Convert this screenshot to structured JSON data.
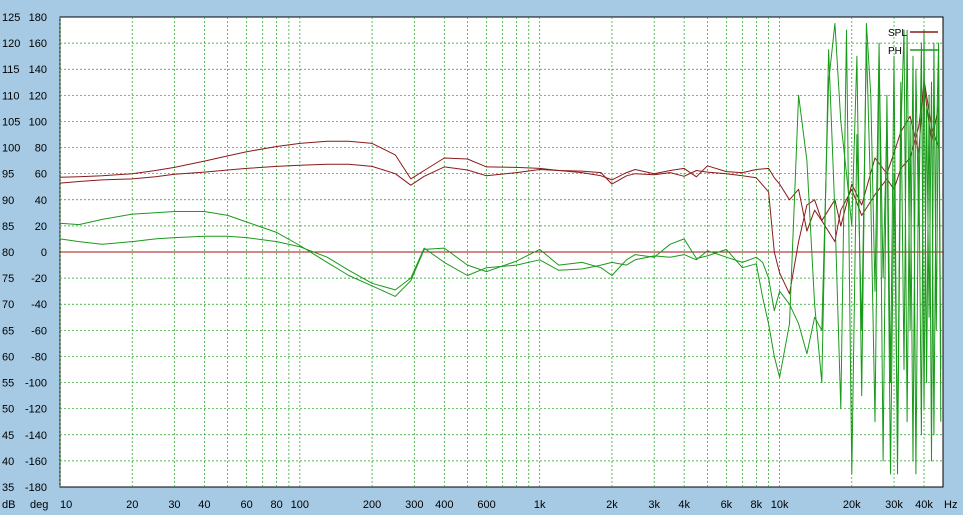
{
  "chart_data": {
    "type": "line",
    "xscale": "log",
    "xlim": [
      10,
      48000
    ],
    "ylim_db": [
      35,
      125
    ],
    "ylim_deg": [
      -180,
      180
    ],
    "grid": true,
    "legend_placement": "top-right",
    "legend": [
      {
        "label": "SPL",
        "color": "#8b1a1a"
      },
      {
        "label": "PH",
        "color": "#1a9a1a"
      }
    ],
    "y_left_ticks": [
      "125",
      "120",
      "115",
      "110",
      "105",
      "100",
      "95",
      "90",
      "85",
      "80",
      "75",
      "70",
      "65",
      "60",
      "55",
      "50",
      "45",
      "40",
      "35"
    ],
    "y_right_ticks": [
      "180",
      "160",
      "140",
      "120",
      "100",
      "80",
      "60",
      "40",
      "20",
      "0",
      "-20",
      "-40",
      "-60",
      "-80",
      "-100",
      "-120",
      "-140",
      "-160",
      "-180"
    ],
    "y_left_unit": "dB",
    "y_right_unit": "deg",
    "x_ticks": [
      {
        "v": 10,
        "label": "10"
      },
      {
        "v": 20,
        "label": "20"
      },
      {
        "v": 30,
        "label": "30"
      },
      {
        "v": 40,
        "label": "40"
      },
      {
        "v": 60,
        "label": "60"
      },
      {
        "v": 80,
        "label": "80"
      },
      {
        "v": 100,
        "label": "100"
      },
      {
        "v": 200,
        "label": "200"
      },
      {
        "v": 300,
        "label": "300"
      },
      {
        "v": 400,
        "label": "400"
      },
      {
        "v": 600,
        "label": "600"
      },
      {
        "v": 1000,
        "label": "1k"
      },
      {
        "v": 2000,
        "label": "2k"
      },
      {
        "v": 3000,
        "label": "3k"
      },
      {
        "v": 4000,
        "label": "4k"
      },
      {
        "v": 6000,
        "label": "6k"
      },
      {
        "v": 8000,
        "label": "8k"
      },
      {
        "v": 10000,
        "label": "10k"
      },
      {
        "v": 20000,
        "label": "20k"
      },
      {
        "v": 30000,
        "label": "30k"
      },
      {
        "v": 40000,
        "label": "40k"
      }
    ],
    "x_unit": "Hz",
    "zero_line_db": 80,
    "series": [
      {
        "name": "SPL",
        "color": "#8b1a1a",
        "x": [
          10,
          12,
          15,
          20,
          25,
          30,
          40,
          50,
          60,
          80,
          100,
          130,
          160,
          200,
          250,
          290,
          330,
          400,
          500,
          600,
          800,
          1000,
          1200,
          1500,
          1800,
          2000,
          2300,
          2500,
          3000,
          3500,
          4000,
          4500,
          5000,
          6000,
          7000,
          8000,
          9000,
          9500,
          10000,
          11000,
          12000,
          13000,
          14000,
          15000,
          17000,
          18000,
          20000,
          22000,
          25000,
          28000,
          30000,
          32000,
          35000,
          38000,
          40000,
          43000,
          46000
        ],
        "y": [
          93.2,
          93.5,
          93.8,
          94,
          94.4,
          94.9,
          95.3,
          95.7,
          96.0,
          96.4,
          96.6,
          96.8,
          96.8,
          96.4,
          95.0,
          92.8,
          94.5,
          96.3,
          95.7,
          94.6,
          95.2,
          95.8,
          95.6,
          95.5,
          95.2,
          93.0,
          94.6,
          95.0,
          94.8,
          95.2,
          94.5,
          95.6,
          95.3,
          95.0,
          94.6,
          94.2,
          91.5,
          80.0,
          76.0,
          72.0,
          82.0,
          89.0,
          90.0,
          86.0,
          82.0,
          88.0,
          92.0,
          87.0,
          91.0,
          94.0,
          92.0,
          96.0,
          98.0,
          104.0,
          112.0,
          101.0,
          108.0
        ]
      },
      {
        "name": "SPL",
        "color": "#8b1a1a",
        "x": [
          10,
          12,
          15,
          20,
          25,
          30,
          40,
          50,
          60,
          80,
          100,
          130,
          160,
          200,
          250,
          290,
          330,
          400,
          500,
          600,
          800,
          1000,
          1200,
          1500,
          1800,
          2000,
          2300,
          2500,
          3000,
          3500,
          4000,
          4500,
          5000,
          6000,
          7000,
          8000,
          9000,
          9500,
          10000,
          11000,
          12000,
          13000,
          14000,
          15000,
          17000,
          18000,
          20000,
          22000,
          25000,
          28000,
          30000,
          32000,
          35000,
          38000,
          40000,
          43000,
          46000
        ],
        "y": [
          94.3,
          94.4,
          94.6,
          95.0,
          95.6,
          96.2,
          97.4,
          98.4,
          99.2,
          100.2,
          100.8,
          101.2,
          101.2,
          100.8,
          98.6,
          94.0,
          95.6,
          98.0,
          97.8,
          96.3,
          96.2,
          96.0,
          95.6,
          95.2,
          94.6,
          93.8,
          95.2,
          95.8,
          95.0,
          95.6,
          96.0,
          94.4,
          96.5,
          95.4,
          95.2,
          95.8,
          96.0,
          94.2,
          93.0,
          90.0,
          92.0,
          84.0,
          88.0,
          86.0,
          90.0,
          85.0,
          93.0,
          89.0,
          98.0,
          95.0,
          99.0,
          103.0,
          106.0,
          99.0,
          113.0,
          104.0,
          100.0
        ]
      },
      {
        "name": "PH",
        "color": "#1a9a1a",
        "x": [
          10,
          12,
          15,
          20,
          25,
          30,
          40,
          50,
          60,
          80,
          100,
          130,
          160,
          200,
          250,
          290,
          330,
          400,
          500,
          600,
          800,
          1000,
          1200,
          1500,
          1800,
          2000,
          2300,
          2500,
          3000,
          3500,
          4000,
          4500,
          5000,
          6000,
          7000,
          8000,
          8500,
          9000,
          9500,
          10000,
          11000,
          12000,
          13000,
          14000,
          15000,
          16000,
          17000,
          18000,
          19000,
          20000,
          21000,
          22000,
          23000,
          24000,
          25000,
          26000,
          27000,
          28000,
          29000,
          30000,
          31000,
          32000,
          33000,
          34000,
          35000,
          36000,
          37000,
          38000,
          39000,
          40000,
          41000,
          42000,
          43000,
          44000,
          45000,
          46000,
          47000
        ],
        "y": [
          22,
          21,
          25,
          29,
          30,
          31,
          31,
          28,
          23,
          15,
          5,
          -8,
          -18,
          -26,
          -34,
          -22,
          2,
          3,
          -10,
          -15,
          -7,
          2,
          -10,
          -8,
          -12,
          -18,
          -6,
          -2,
          -4,
          6,
          10,
          -5,
          -3,
          2,
          -12,
          -9,
          -35,
          -55,
          -80,
          -96,
          -55,
          120,
          70,
          -40,
          -100,
          155,
          30,
          -120,
          170,
          -170,
          90,
          -60,
          160,
          40,
          -130,
          150,
          -20,
          100,
          -170,
          60,
          -150,
          130,
          -90,
          170,
          -60,
          150,
          -170,
          80,
          -140,
          170,
          -100,
          120,
          -160,
          160,
          -60,
          140,
          -130
        ]
      },
      {
        "name": "PH",
        "color": "#1a9a1a",
        "x": [
          10,
          12,
          15,
          20,
          25,
          30,
          40,
          50,
          60,
          80,
          100,
          130,
          160,
          200,
          250,
          290,
          330,
          400,
          500,
          600,
          800,
          1000,
          1200,
          1500,
          1800,
          2000,
          2300,
          2500,
          3000,
          3500,
          4000,
          4500,
          5000,
          6000,
          7000,
          8000,
          8500,
          9000,
          9500,
          10000,
          11000,
          12000,
          13000,
          14000,
          15000,
          16000,
          17000,
          18000,
          19000,
          20000,
          21000,
          22000,
          23000,
          24000,
          25000,
          26000,
          27000,
          28000,
          29000,
          30000,
          31000,
          32000,
          33000,
          34000,
          35000,
          36000,
          37000,
          38000,
          39000,
          40000,
          41000,
          42000,
          43000,
          44000,
          45000,
          46000,
          47000
        ],
        "y": [
          10,
          8,
          6,
          8,
          10,
          11,
          12,
          12,
          11,
          8,
          4,
          -4,
          -14,
          -24,
          -29,
          -20,
          3,
          -8,
          -18,
          -12,
          -10,
          -6,
          -14,
          -13,
          -10,
          -8,
          -10,
          -6,
          -3,
          -4,
          -2,
          -6,
          1,
          -4,
          -8,
          -4,
          -8,
          -20,
          -45,
          -30,
          -40,
          -55,
          -78,
          -50,
          -60,
          130,
          175,
          100,
          60,
          20,
          150,
          -110,
          175,
          120,
          -30,
          160,
          -160,
          120,
          -100,
          150,
          -170,
          90,
          170,
          -130,
          100,
          -160,
          140,
          20,
          160,
          -120,
          110,
          -50,
          130,
          -140,
          80,
          160,
          -90
        ]
      }
    ]
  }
}
